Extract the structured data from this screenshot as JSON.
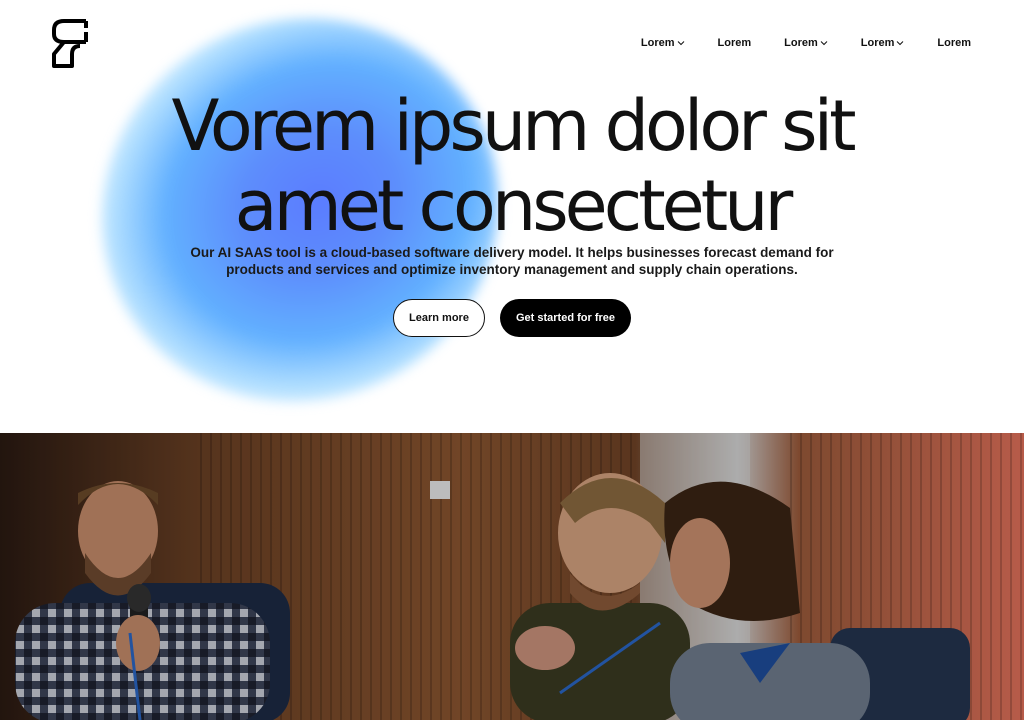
{
  "brand": {
    "logo_icon": "brand-logo-icon"
  },
  "nav": {
    "items": [
      {
        "label": "Lorem",
        "has_dropdown": true
      },
      {
        "label": "Lorem",
        "has_dropdown": false
      },
      {
        "label": "Lorem",
        "has_dropdown": true
      },
      {
        "label": "Lorem",
        "has_dropdown": true
      },
      {
        "label": "Lorem",
        "has_dropdown": false
      }
    ]
  },
  "hero": {
    "title_line1": "Vorem ipsum dolor sit",
    "title_line2": "amet consectetur",
    "subtitle_line1": "Our AI SAAS tool is a cloud-based software delivery model. It helps businesses forecast demand for",
    "subtitle_line2": "products and services and optimize inventory management and supply chain operations.",
    "secondary_cta": "Learn more",
    "primary_cta": "Get started for free"
  },
  "colors": {
    "accent_blue": "#5b7cff",
    "accent_light_blue": "#62b0ff",
    "primary_button": "#000000",
    "text": "#111111"
  }
}
